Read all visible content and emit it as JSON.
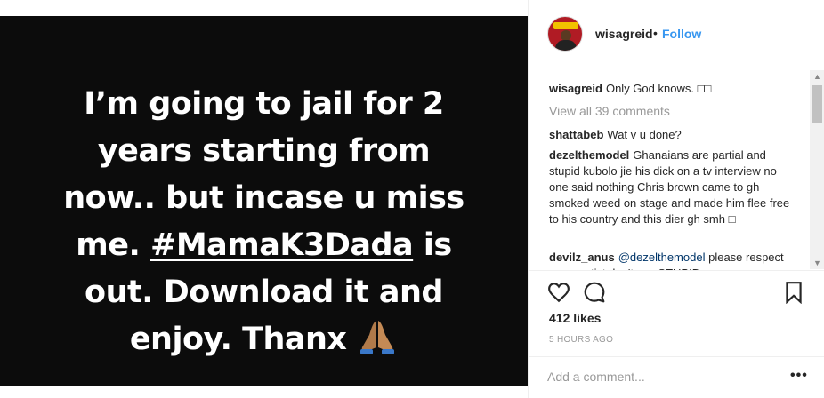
{
  "post": {
    "caption_lines": [
      {
        "pre": "I’m going to jail for 2",
        "link": "",
        "post": ""
      },
      {
        "pre": "years starting from",
        "link": "",
        "post": ""
      },
      {
        "pre": "now.. but incase u miss",
        "link": "",
        "post": ""
      },
      {
        "pre": "me. ",
        "link": "#MamaK3Dada",
        "post": " is"
      },
      {
        "pre": "out. Download it and",
        "link": "",
        "post": ""
      },
      {
        "pre": "enjoy. Thanx ",
        "link": "",
        "post": ""
      }
    ],
    "emoji": "praying-hands-icon",
    "background_color": "#0c0c0c"
  },
  "header": {
    "username": "wisagreid",
    "separator": "•",
    "follow_label": "Follow",
    "follow_color": "#3897f0"
  },
  "comments": {
    "caption": {
      "user": "wisagreid",
      "text": "Only God knows. □□"
    },
    "view_all": "View all 39 comments",
    "items": [
      {
        "user": "shattabeb",
        "text": "Wat v u done?"
      },
      {
        "user": "dezelthemodel",
        "text": "Ghanaians are partial and stupid kubolo jie his dick on a tv interview no one said nothing Chris brown came to gh smoked weed on stage and made him flee free to his country and this dier gh smh □"
      },
      {
        "user": "devilz_anus",
        "mention": "@dezelthemodel",
        "text": "please respect every artist don't say STUPID"
      }
    ]
  },
  "actions": {
    "like_icon": "heart-outline-icon",
    "comment_icon": "comment-bubble-icon",
    "save_icon": "bookmark-icon"
  },
  "likes": "412 likes",
  "timestamp": "5 HOURS AGO",
  "add_comment": {
    "placeholder": "Add a comment...",
    "more_label": "•••"
  }
}
